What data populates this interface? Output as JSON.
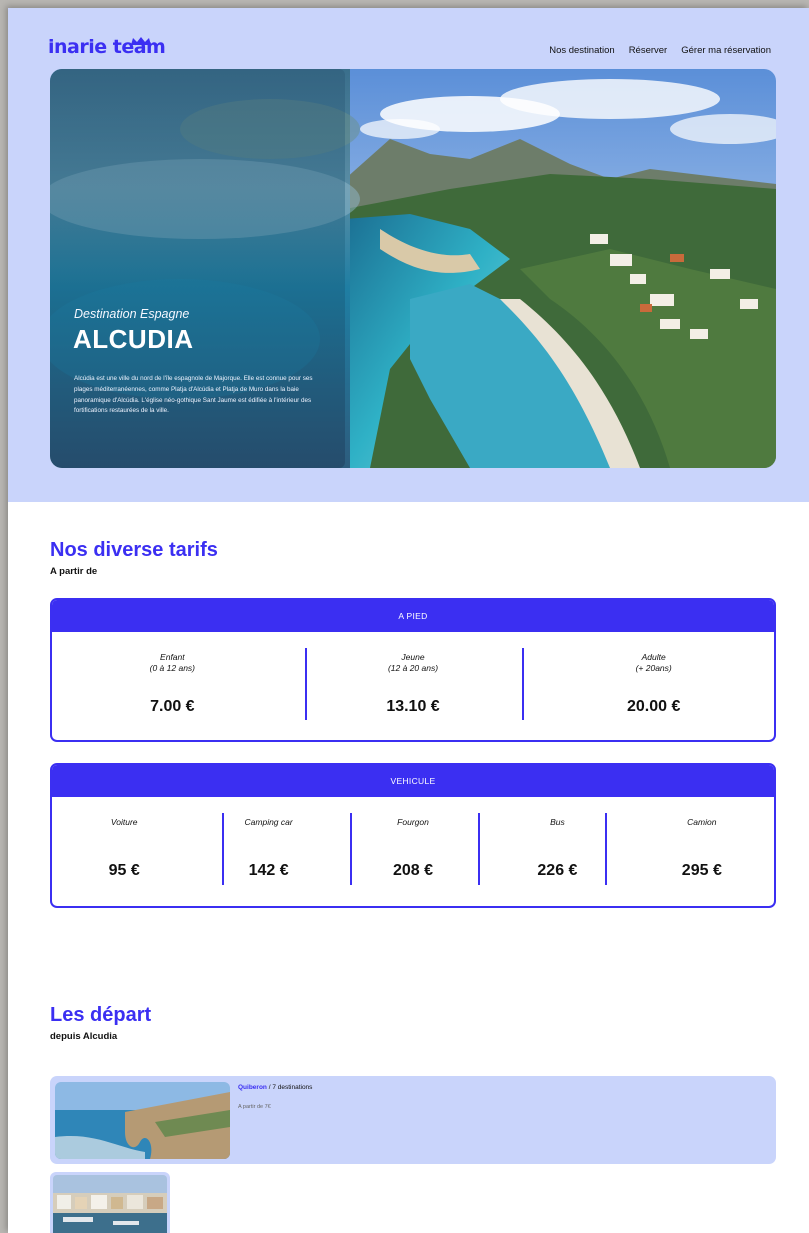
{
  "brand": {
    "logo_text": "inarie team"
  },
  "nav": [
    "Nos destination",
    "Réserver",
    "Gérer ma réservation"
  ],
  "hero": {
    "subtitle": "Destination Espagne",
    "title": "ALCUDIA",
    "description": "Alcúdia est une ville du nord de l'île espagnole de Majorque. Elle est connue pour ses plages méditerranéennes, comme Platja d'Alcúdia et Platja de Muro dans la baie panoramique d'Alcúdia. L'église néo-gothique Sant Jaume est édifiée à l'intérieur des fortifications restaurées de la ville."
  },
  "tarifs": {
    "title": "Nos diverse tarifs",
    "subtitle": "A partir de",
    "pied": {
      "header": "A PIED",
      "items": [
        {
          "label": "Enfant",
          "detail": "(0 à 12 ans)",
          "price": "7.00 €"
        },
        {
          "label": "Jeune",
          "detail": "(12 à 20 ans)",
          "price": "13.10 €"
        },
        {
          "label": "Adulte",
          "detail": "(+ 20ans)",
          "price": "20.00 €"
        }
      ]
    },
    "vehicule": {
      "header": "VEHICULE",
      "items": [
        {
          "label": "Voiture",
          "price": "95 €"
        },
        {
          "label": "Camping car",
          "price": "142 €"
        },
        {
          "label": "Fourgon",
          "price": "208 €"
        },
        {
          "label": "Bus",
          "price": "226 €"
        },
        {
          "label": "Camion",
          "price": "295 €"
        }
      ]
    }
  },
  "departs": {
    "title": "Les départ",
    "subtitle": "depuis Alcudia",
    "items": [
      {
        "name": "Quiberon",
        "destinations": "/ 7 destinations",
        "from": "A partir de 7€"
      }
    ]
  },
  "colors": {
    "accent": "#3b2ff2",
    "light": "#c9d4fb"
  }
}
